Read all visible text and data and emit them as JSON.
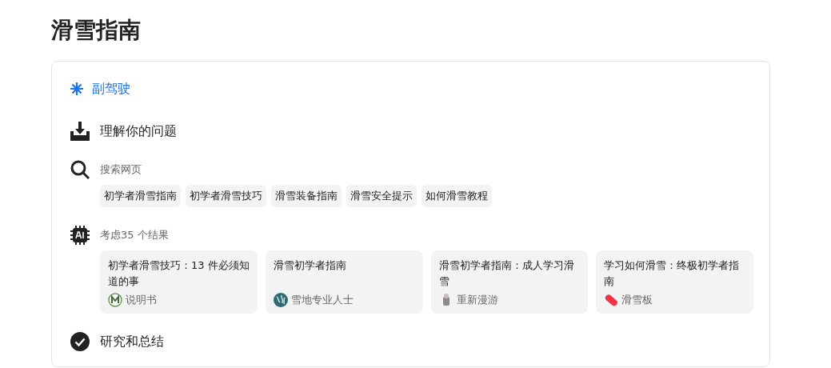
{
  "title": "滑雪指南",
  "copilot": {
    "label": "副驾驶"
  },
  "steps": [
    {
      "kind": "understand",
      "label": "理解你的问题"
    },
    {
      "kind": "search",
      "label": "搜索网页",
      "chips": [
        "初学者滑雪指南",
        "初学者滑雪技巧",
        "滑雪装备指南",
        "滑雪安全提示",
        "如何滑雪教程"
      ]
    },
    {
      "kind": "results",
      "label": "考虑35 个结果",
      "results": [
        {
          "title": "初学者滑雪技巧：13 件必须知道的事",
          "source": "说明书",
          "kind": "letter"
        },
        {
          "title": "滑雪初学者指南",
          "source": "雪地专业人士",
          "kind": "pattern"
        },
        {
          "title": "滑雪初学者指南：成人学习滑雪",
          "source": "重新漫游",
          "kind": "figure"
        },
        {
          "title": "学习如何滑雪：终极初学者指南",
          "source": "滑雪板",
          "kind": "board"
        }
      ]
    },
    {
      "kind": "done",
      "label": "研究和总结"
    }
  ]
}
